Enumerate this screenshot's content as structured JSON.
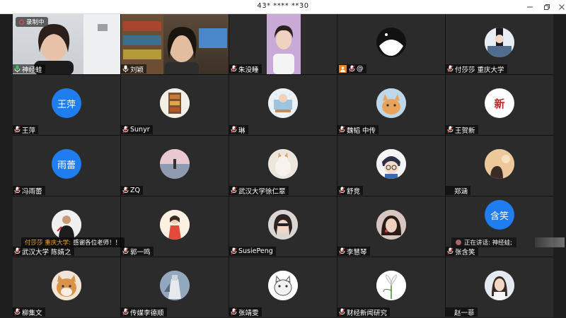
{
  "window": {
    "title": "43* **** **30"
  },
  "recording_label": "录制中",
  "chat": {
    "from": "付莎莎 重庆大学:",
    "message": "感谢各位老师！！"
  },
  "speaking": {
    "label": "正在讲话: 神经蛙;"
  },
  "tiles": [
    {
      "name": "神经蛙",
      "mic": "active"
    },
    {
      "name": "刘颖",
      "mic": "normal"
    },
    {
      "name": "朱没睡",
      "mic": "muted"
    },
    {
      "name": "@",
      "mic": "muted"
    },
    {
      "name": "付莎莎 重庆大学",
      "mic": "muted"
    },
    {
      "name": "王萍",
      "mic": "muted",
      "avatar_text": "王萍"
    },
    {
      "name": "Sunyr",
      "mic": "muted"
    },
    {
      "name": "琳",
      "mic": "muted"
    },
    {
      "name": "魏韬 中传",
      "mic": "muted"
    },
    {
      "name": "王贺新",
      "mic": "muted",
      "avatar_text": "新"
    },
    {
      "name": "冯雨蕾",
      "mic": "muted",
      "avatar_text": "雨蕾"
    },
    {
      "name": "ZQ",
      "mic": "muted"
    },
    {
      "name": "武汉大学徐仁翠",
      "mic": "muted"
    },
    {
      "name": "舒竞",
      "mic": "muted"
    },
    {
      "name": "郑涵",
      "mic": "none"
    },
    {
      "name": "武汉大学 陈婧之",
      "mic": "muted"
    },
    {
      "name": "郭一鸣",
      "mic": "muted"
    },
    {
      "name": "SusiePeng",
      "mic": "muted"
    },
    {
      "name": "李慧琴",
      "mic": "muted"
    },
    {
      "name": "张含笑",
      "mic": "muted",
      "avatar_text": "含笑"
    },
    {
      "name": "柳集文",
      "mic": "muted"
    },
    {
      "name": "传媒李德顺",
      "mic": "muted"
    },
    {
      "name": "张靖雯",
      "mic": "muted"
    },
    {
      "name": "财经新闻研究",
      "mic": "muted"
    },
    {
      "name": "赵一菲",
      "mic": "none"
    }
  ]
}
